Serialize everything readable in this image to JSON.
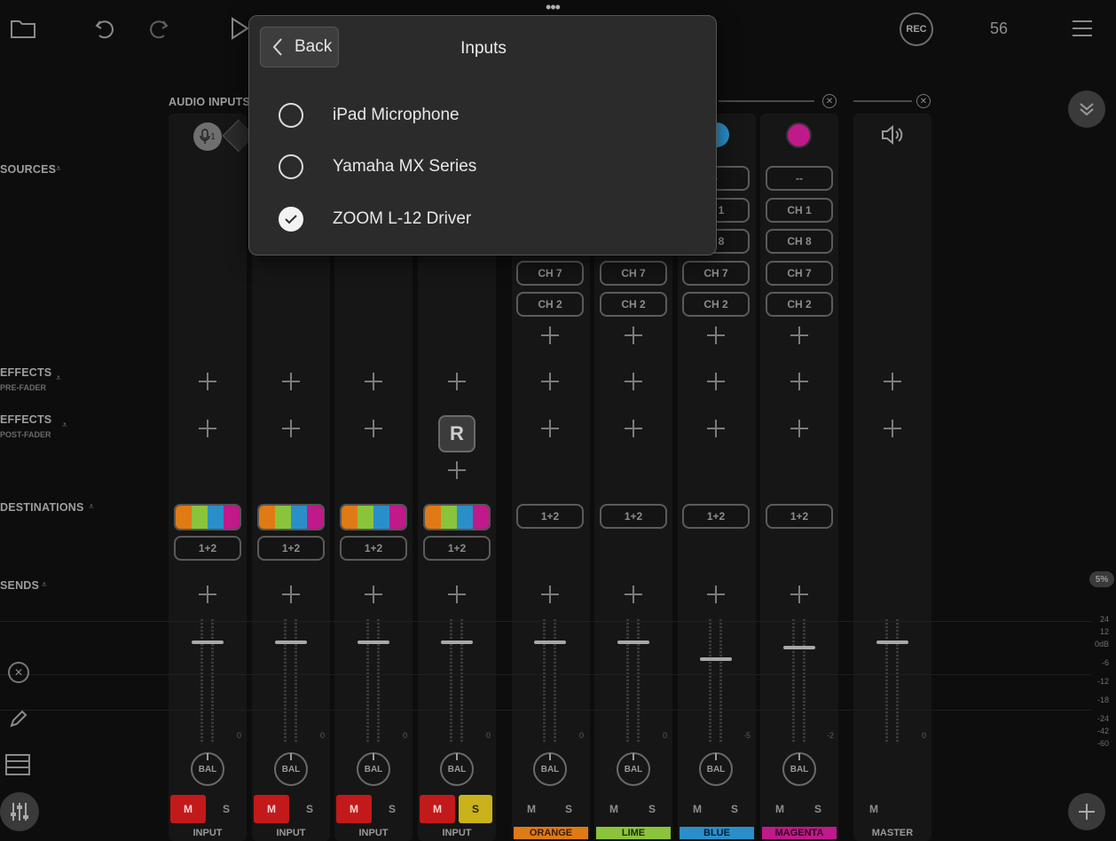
{
  "topbar": {
    "counter": "56",
    "rec_label": "REC",
    "more": "•••"
  },
  "sections": {
    "audio_inputs": "AUDIO INPUTS",
    "sources": "SOURCES",
    "effects_pre": "EFFECTS",
    "effects_pre_sub": "PRE-FADER",
    "effects_post": "EFFECTS",
    "effects_post_sub": "POST-FADER",
    "destinations": "DESTINATIONS",
    "sends": "SENDS"
  },
  "popup": {
    "back_label": "Back",
    "title": "Inputs",
    "options": [
      {
        "label": "iPad Microphone",
        "selected": false
      },
      {
        "label": "Yamaha MX Series",
        "selected": false
      },
      {
        "label": "ZOOM L-12 Driver",
        "selected": true
      }
    ]
  },
  "input_icon_label": "1",
  "bus_rows": {
    "dash": "--",
    "ch1": "CH 1",
    "ch8": "CH 8",
    "ch7": "CH 7",
    "ch2": "CH 2",
    "blue_ch1_partial": "H 1",
    "blue_ch8_partial": "H 8",
    "blue_dash_partial": "-"
  },
  "reverb_plugin_letter": "R",
  "dest_label": "1+2",
  "bal_label": "BAL",
  "mute_label": "M",
  "solo_label": "S",
  "zero_labels": [
    "0",
    "0",
    "0",
    "0",
    "0",
    "0",
    "-5",
    "-2",
    "0"
  ],
  "channel_names": [
    "INPUT",
    "INPUT",
    "INPUT",
    "INPUT",
    "ORANGE",
    "LIME",
    "BLUE",
    "MAGENTA",
    "MASTER"
  ],
  "meter_scale": [
    "24",
    "12",
    "0dB",
    "-6",
    "-12",
    "-18",
    "-24",
    "-42",
    "-60"
  ],
  "zoom_badge": "5%",
  "colors": {
    "orange": "#e07a14",
    "lime": "#8ac43a",
    "blue": "#2a8fc9",
    "magenta": "#c0198a",
    "mute_red": "#c21a1a",
    "solo_yellow": "#c9b21a"
  }
}
